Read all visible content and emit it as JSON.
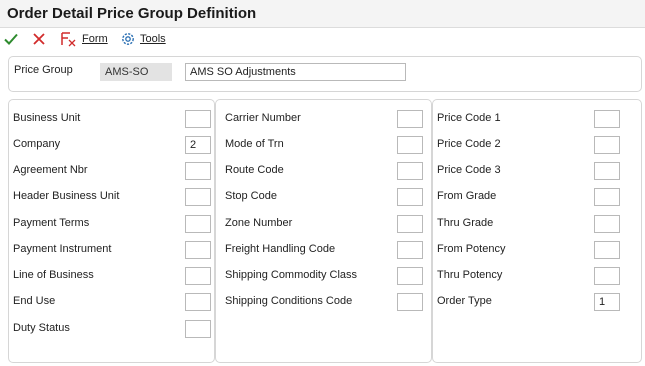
{
  "window": {
    "title": "Order Detail Price Group Definition"
  },
  "toolbar": {
    "ok_icon": "checkmark-icon",
    "cancel_icon": "x-icon",
    "form_label": "Form",
    "tools_label": "Tools",
    "accent_green": "#2e8b2e",
    "accent_red": "#d12b2b",
    "accent_blue": "#2a6fb3"
  },
  "header": {
    "price_group_label": "Price Group",
    "price_group_code": "AMS-SO",
    "price_group_desc": "AMS SO Adjustments"
  },
  "columns": {
    "left": [
      {
        "label": "Business Unit",
        "value": ""
      },
      {
        "label": "Company",
        "value": "2"
      },
      {
        "label": "Agreement Nbr",
        "value": ""
      },
      {
        "label": "Header Business Unit",
        "value": ""
      },
      {
        "label": "Payment Terms",
        "value": ""
      },
      {
        "label": "Payment Instrument",
        "value": ""
      },
      {
        "label": "Line of Business",
        "value": ""
      },
      {
        "label": "End Use",
        "value": ""
      },
      {
        "label": "Duty Status",
        "value": ""
      }
    ],
    "middle": [
      {
        "label": "Carrier Number",
        "value": ""
      },
      {
        "label": "Mode of Trn",
        "value": ""
      },
      {
        "label": "Route Code",
        "value": ""
      },
      {
        "label": "Stop Code",
        "value": ""
      },
      {
        "label": "Zone Number",
        "value": ""
      },
      {
        "label": "Freight Handling Code",
        "value": ""
      },
      {
        "label": "Shipping Commodity Class",
        "value": ""
      },
      {
        "label": "Shipping Conditions Code",
        "value": ""
      }
    ],
    "right": [
      {
        "label": "Price Code 1",
        "value": ""
      },
      {
        "label": "Price Code 2",
        "value": ""
      },
      {
        "label": "Price Code 3",
        "value": ""
      },
      {
        "label": "From Grade",
        "value": ""
      },
      {
        "label": "Thru Grade",
        "value": ""
      },
      {
        "label": "From Potency",
        "value": ""
      },
      {
        "label": "Thru Potency",
        "value": ""
      },
      {
        "label": "Order Type",
        "value": "1"
      }
    ]
  }
}
